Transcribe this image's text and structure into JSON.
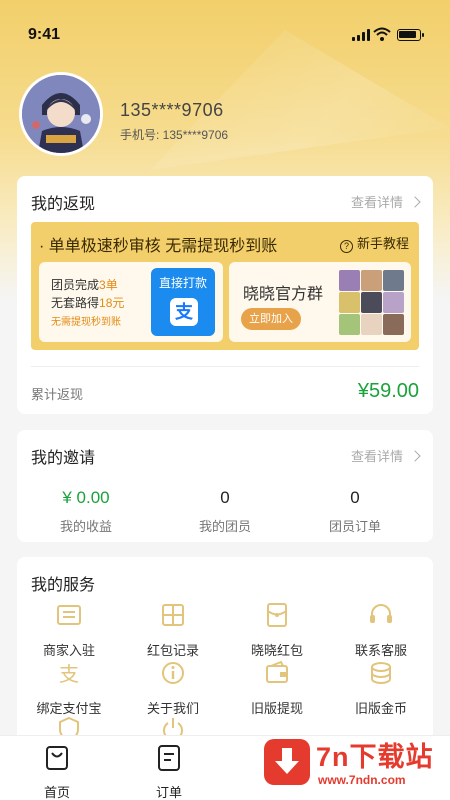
{
  "status_bar": {
    "time": "9:41"
  },
  "profile": {
    "username": "135****9706",
    "phone_label": "手机号: 135****9706"
  },
  "rebate": {
    "title": "我的返现",
    "more": "查看详情",
    "banner": {
      "headline": "· 单单极速秒审核 无需提现秒到账",
      "help": "新手教程",
      "promo_line1_prefix": "团员完成",
      "promo_line1_highlight": "3单",
      "promo_line2_prefix": "无套路得",
      "promo_line2_highlight": "18元",
      "promo_line3": "无需提现秒到账",
      "alipay_title": "直接打款",
      "alipay_glyph": "支",
      "group_name": "晓晓官方群",
      "join_button": "立即加入"
    },
    "accum_label": "累计返现",
    "accum_value": "¥59.00"
  },
  "invite": {
    "title": "我的邀请",
    "more": "查看详情",
    "stats": [
      {
        "value": "¥ 0.00",
        "label": "我的收益"
      },
      {
        "value": "0",
        "label": "我的团员"
      },
      {
        "value": "0",
        "label": "团员订单"
      }
    ]
  },
  "services": {
    "title": "我的服务",
    "items": [
      {
        "label": "商家入驻",
        "icon": "store-icon"
      },
      {
        "label": "红包记录",
        "icon": "grid-icon"
      },
      {
        "label": "晓晓红包",
        "icon": "envelope-icon"
      },
      {
        "label": "联系客服",
        "icon": "headset-icon"
      },
      {
        "label": "绑定支付宝",
        "icon": "alipay-icon"
      },
      {
        "label": "关于我们",
        "icon": "info-icon"
      },
      {
        "label": "旧版提现",
        "icon": "wallet-icon"
      },
      {
        "label": "旧版金币",
        "icon": "coins-icon"
      },
      {
        "label": "",
        "icon": "shield-icon"
      },
      {
        "label": "",
        "icon": "power-icon"
      }
    ]
  },
  "tabbar": [
    {
      "label": "首页",
      "icon": "shopping-bag-icon"
    },
    {
      "label": "订单",
      "icon": "order-list-icon"
    }
  ],
  "watermark": {
    "title": "7n下载站",
    "url": "www.7ndn.com"
  },
  "colors": {
    "accent": "#f3cf6b",
    "green": "#1aa33b",
    "orange": "#e48b16",
    "alipay_blue": "#1b8bef",
    "watermark_red": "#e53a2e"
  }
}
